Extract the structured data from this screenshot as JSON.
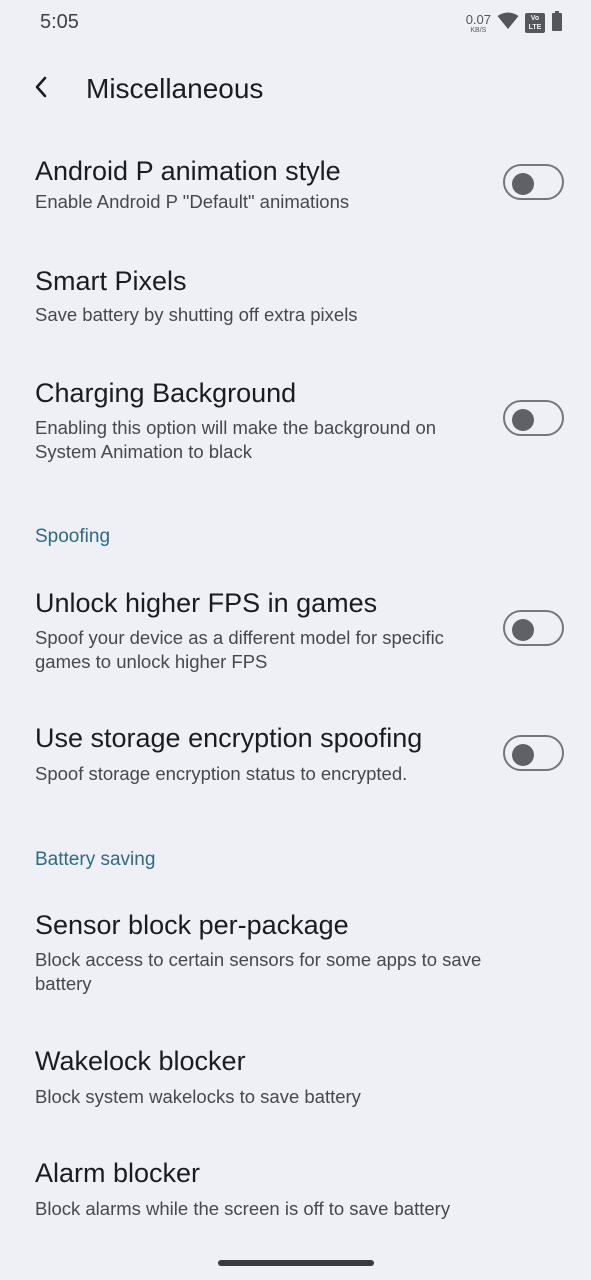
{
  "status_bar": {
    "time": "5:05",
    "net_speed_value": "0.07",
    "net_speed_unit": "KB/S",
    "volte_top": "Vo",
    "volte_bottom": "LTE",
    "icons": [
      "wifi-icon",
      "volte-icon",
      "battery-icon"
    ]
  },
  "app_bar": {
    "title": "Miscellaneous",
    "back_icon": "arrow-back-icon"
  },
  "items": [
    {
      "title": "Android P animation style",
      "subtitle": "Enable Android P \"Default\" animations",
      "toggle": false
    },
    {
      "title": "Smart Pixels",
      "subtitle": "Save battery by shutting off extra pixels"
    },
    {
      "title": "Charging Background",
      "subtitle": "Enabling this option will make the background on System Animation to black",
      "toggle": false
    },
    {
      "title": "Unlock higher FPS in games",
      "subtitle": "Spoof your device as a different model for specific games to unlock higher FPS",
      "toggle": false
    },
    {
      "title": "Use storage encryption spoofing",
      "subtitle": "Spoof storage encryption status to encrypted.",
      "toggle": false
    },
    {
      "title": "Sensor block per-package",
      "subtitle": "Block access to certain sensors for some apps to save battery"
    },
    {
      "title": "Wakelock blocker",
      "subtitle": "Block system wakelocks to save battery"
    },
    {
      "title": "Alarm blocker",
      "subtitle": "Block alarms while the screen is off to save battery"
    }
  ],
  "categories": {
    "spoofing": "Spoofing",
    "battery_saving": "Battery saving"
  },
  "colors": {
    "background": "#eff0f5",
    "accent": "#2b6a8a",
    "switch_off": "#5f6167"
  }
}
